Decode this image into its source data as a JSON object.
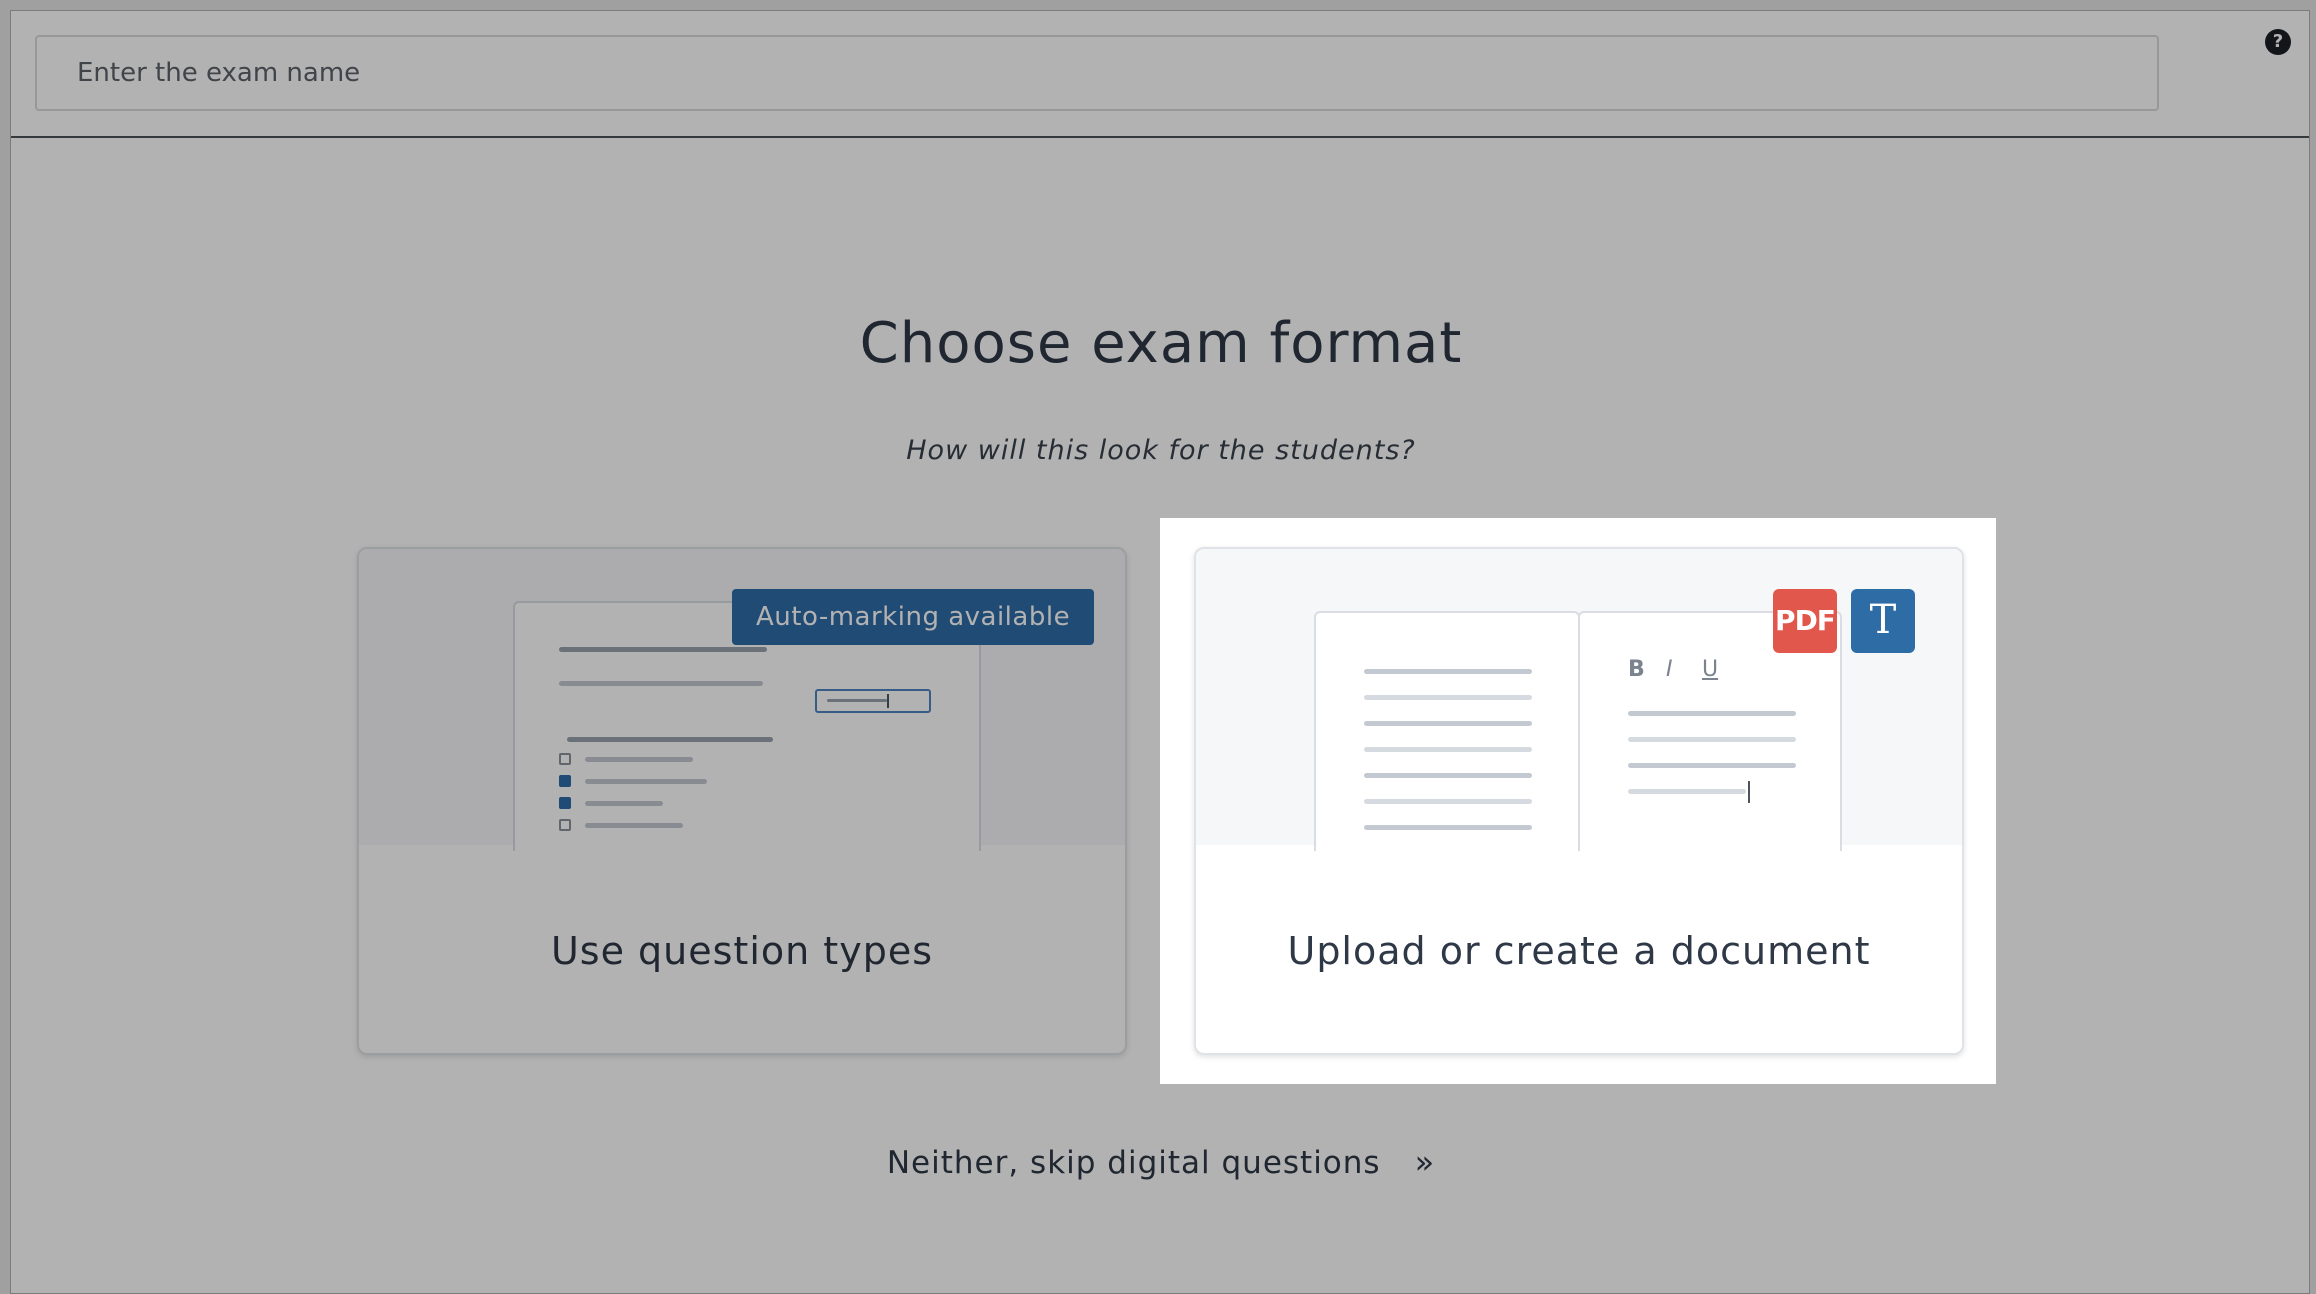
{
  "header": {
    "exam_name_placeholder": "Enter the exam name",
    "help_icon": "?"
  },
  "main": {
    "title": "Choose exam format",
    "subtitle": "How will this look for the students?",
    "cards": [
      {
        "label": "Use question types",
        "badge": "Auto-marking available",
        "preview_icon": "question-types-preview"
      },
      {
        "label": "Upload or create a document",
        "pdf_badge": "PDF",
        "text_badge": "T",
        "format_buttons": [
          "B",
          "I",
          "U"
        ],
        "preview_icon": "document-preview"
      }
    ],
    "skip_label": "Neither, skip digital questions",
    "skip_chevron": "»"
  },
  "colors": {
    "accent": "#2e6ca6",
    "pdf": "#e2574c",
    "text": "#2e3846"
  }
}
